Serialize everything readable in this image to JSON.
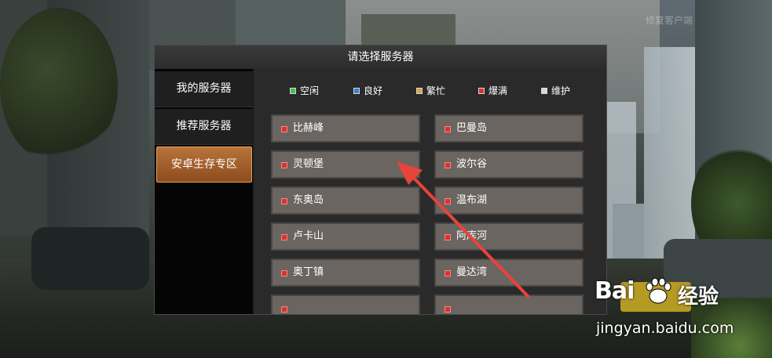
{
  "dialog": {
    "title": "请选择服务器"
  },
  "sidebar": {
    "items": [
      {
        "label": "我的服务器",
        "active": false
      },
      {
        "label": "推荐服务器",
        "active": false
      },
      {
        "label": "安卓生存专区",
        "active": true
      }
    ]
  },
  "legend": [
    {
      "label": "空闲",
      "color": "#3fc24a"
    },
    {
      "label": "良好",
      "color": "#3a7fd0"
    },
    {
      "label": "繁忙",
      "color": "#d9a43a"
    },
    {
      "label": "爆满",
      "color": "#d9342e"
    },
    {
      "label": "维护",
      "color": "#d8d8d8"
    }
  ],
  "servers": [
    {
      "name": "比赫峰",
      "status": "爆满"
    },
    {
      "name": "巴曼岛",
      "status": "爆满"
    },
    {
      "name": "灵顿堡",
      "status": "爆满"
    },
    {
      "name": "波尔谷",
      "status": "爆满"
    },
    {
      "name": "东奥岛",
      "status": "爆满"
    },
    {
      "name": "温布湖",
      "status": "爆满"
    },
    {
      "name": "卢卡山",
      "status": "爆满"
    },
    {
      "name": "阿库河",
      "status": "爆满"
    },
    {
      "name": "奥丁镇",
      "status": "爆满"
    },
    {
      "name": "曼达湾",
      "status": "爆满"
    },
    {
      "name": "",
      "status": ""
    },
    {
      "name": "",
      "status": ""
    }
  ],
  "background": {
    "corner_link": "修复客户端"
  },
  "watermark": {
    "brand": "Bai",
    "brand_cn": "经验",
    "url": "jingyan.baidu.com"
  },
  "annotation": {
    "color": "#e8443a",
    "icon": "red-arrow-icon"
  }
}
